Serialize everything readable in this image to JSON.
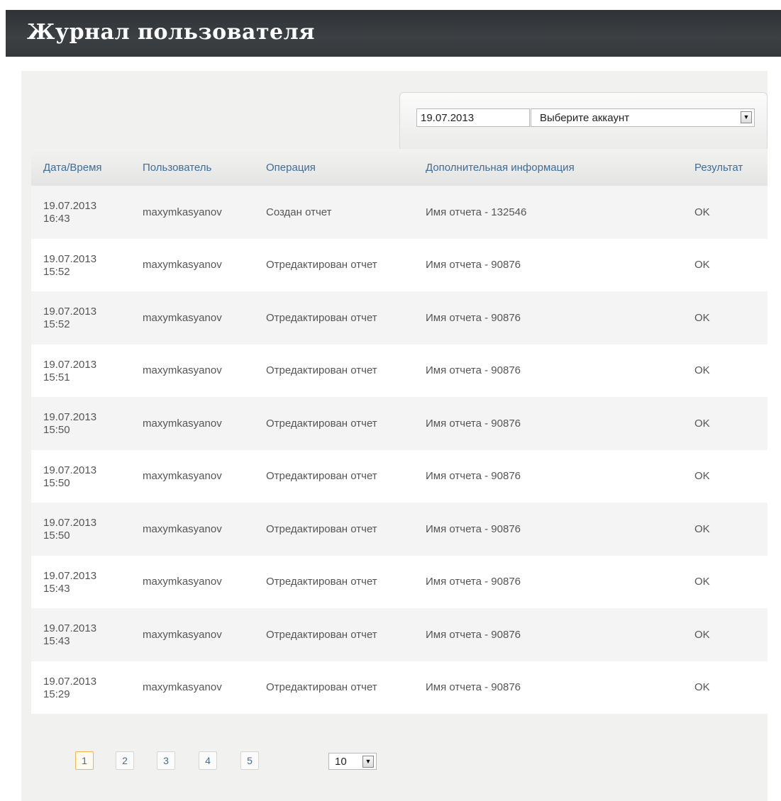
{
  "page": {
    "title": "Журнал пользователя"
  },
  "filters": {
    "date_value": "19.07.2013",
    "account_select_value": "Выберите аккаунт"
  },
  "table": {
    "headers": [
      "Дата/Время",
      "Пользователь",
      "Операция",
      "Дополнительная информация",
      "Результат"
    ],
    "rows": [
      {
        "date": "19.07.2013",
        "time": "16:43",
        "user": "maxymkasyanov",
        "operation": "Создан отчет",
        "info": "Имя отчета - 132546",
        "result": "OK"
      },
      {
        "date": "19.07.2013",
        "time": "15:52",
        "user": "maxymkasyanov",
        "operation": "Отредактирован отчет",
        "info": "Имя отчета - 90876",
        "result": "OK"
      },
      {
        "date": "19.07.2013",
        "time": "15:52",
        "user": "maxymkasyanov",
        "operation": "Отредактирован отчет",
        "info": "Имя отчета - 90876",
        "result": "OK"
      },
      {
        "date": "19.07.2013",
        "time": "15:51",
        "user": "maxymkasyanov",
        "operation": "Отредактирован отчет",
        "info": "Имя отчета - 90876",
        "result": "OK"
      },
      {
        "date": "19.07.2013",
        "time": "15:50",
        "user": "maxymkasyanov",
        "operation": "Отредактирован отчет",
        "info": "Имя отчета - 90876",
        "result": "OK"
      },
      {
        "date": "19.07.2013",
        "time": "15:50",
        "user": "maxymkasyanov",
        "operation": "Отредактирован отчет",
        "info": "Имя отчета - 90876",
        "result": "OK"
      },
      {
        "date": "19.07.2013",
        "time": "15:50",
        "user": "maxymkasyanov",
        "operation": "Отредактирован отчет",
        "info": "Имя отчета - 90876",
        "result": "OK"
      },
      {
        "date": "19.07.2013",
        "time": "15:43",
        "user": "maxymkasyanov",
        "operation": "Отредактирован отчет",
        "info": "Имя отчета - 90876",
        "result": "OK"
      },
      {
        "date": "19.07.2013",
        "time": "15:43",
        "user": "maxymkasyanov",
        "operation": "Отредактирован отчет",
        "info": "Имя отчета - 90876",
        "result": "OK"
      },
      {
        "date": "19.07.2013",
        "time": "15:29",
        "user": "maxymkasyanov",
        "operation": "Отредактирован отчет",
        "info": "Имя отчета - 90876",
        "result": "OK"
      }
    ]
  },
  "pagination": {
    "pages": [
      "1",
      "2",
      "3",
      "4",
      "5"
    ],
    "active_page": "1",
    "per_page_value": "10",
    "dropdown_icon": "triangle-down"
  },
  "colors": {
    "header_bg": "#353a3d",
    "link_blue": "#3f6d96",
    "active_page_border": "#f0b64a"
  }
}
